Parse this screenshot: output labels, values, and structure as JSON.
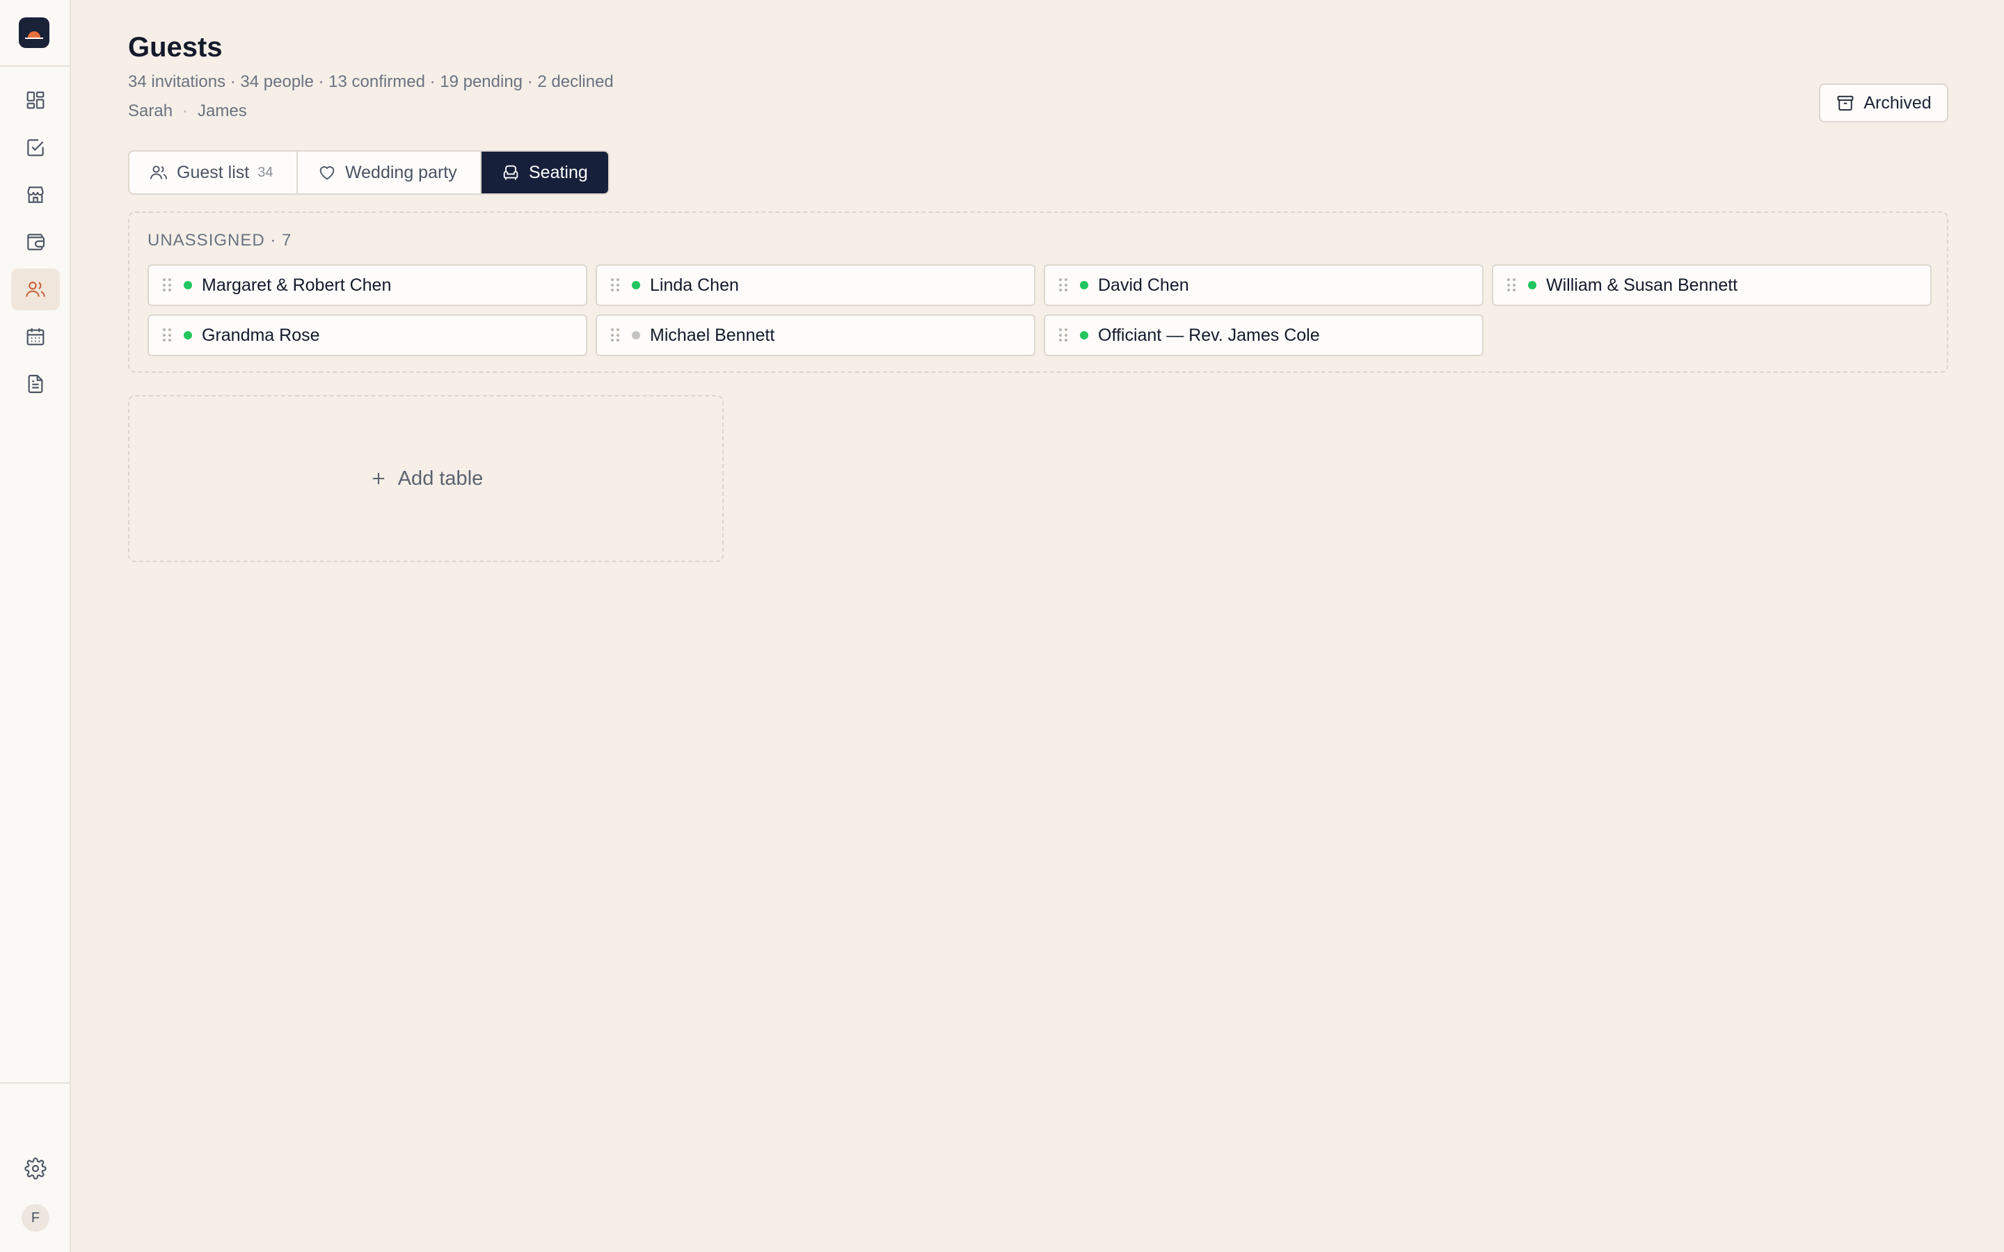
{
  "sidebar": {
    "items": [
      {
        "name": "dashboard",
        "icon": "dashboard-icon",
        "active": false
      },
      {
        "name": "tasks",
        "icon": "checklist-icon",
        "active": false
      },
      {
        "name": "vendors",
        "icon": "store-icon",
        "active": false
      },
      {
        "name": "budget",
        "icon": "wallet-icon",
        "active": false
      },
      {
        "name": "guests",
        "icon": "users-icon",
        "active": true
      },
      {
        "name": "calendar",
        "icon": "calendar-icon",
        "active": false
      },
      {
        "name": "documents",
        "icon": "document-icon",
        "active": false
      }
    ],
    "settings_icon": "gear-icon",
    "avatar_initial": "F"
  },
  "header": {
    "title": "Guests",
    "stats": "34 invitations · 34 people · 13 confirmed · 19 pending · 2 declined",
    "partner_one": "Sarah",
    "partner_two": "James",
    "archived_label": "Archived"
  },
  "tabs": [
    {
      "label": "Guest list",
      "count": "34",
      "icon": "users-icon",
      "active": false
    },
    {
      "label": "Wedding party",
      "icon": "heart-icon",
      "active": false
    },
    {
      "label": "Seating",
      "icon": "chair-icon",
      "active": true
    }
  ],
  "unassigned": {
    "label": "UNASSIGNED · 7",
    "guests": [
      {
        "name": "Margaret & Robert Chen",
        "status": "confirmed"
      },
      {
        "name": "Linda Chen",
        "status": "confirmed"
      },
      {
        "name": "David Chen",
        "status": "confirmed"
      },
      {
        "name": "William & Susan Bennett",
        "status": "confirmed"
      },
      {
        "name": "Grandma Rose",
        "status": "confirmed"
      },
      {
        "name": "Michael Bennett",
        "status": "pending"
      },
      {
        "name": "Officiant — Rev. James Cole",
        "status": "confirmed"
      }
    ]
  },
  "add_table_label": "Add table",
  "colors": {
    "background": "#f5efe8",
    "accent": "#c8653a",
    "active_tab": "#17203a",
    "status_confirmed": "#22c55e",
    "status_pending": "#c4c4c4"
  }
}
